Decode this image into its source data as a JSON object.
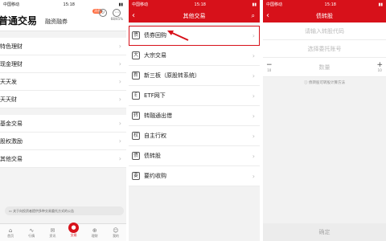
{
  "screen1": {
    "status": {
      "carrier": "中国移动",
      "time": "15:18"
    },
    "title": "普通交易",
    "subtitle": "融资融券",
    "badge": "消息",
    "icon_labels": [
      "",
      "68/45%"
    ],
    "items": [
      "特色理财",
      "现金理财",
      "天天发",
      "天天财",
      "基金交易",
      "股权激励",
      "其他交易"
    ],
    "notice": "关于向投资者提供多种交易委托方式的公告",
    "tabs": [
      {
        "icon": "⌂",
        "label": "首页"
      },
      {
        "icon": "∿",
        "label": "行情"
      },
      {
        "icon": "✉",
        "label": "资讯"
      },
      {
        "icon": "●",
        "label": "交易"
      },
      {
        "icon": "⊕",
        "label": "理财"
      },
      {
        "icon": "☺",
        "label": "我的"
      }
    ]
  },
  "screen2": {
    "status": {
      "carrier": "中国移动",
      "time": "15:18"
    },
    "title": "其他交易",
    "items": [
      {
        "icon": "债",
        "label": "债券回购"
      },
      {
        "icon": "大",
        "label": "大宗交易"
      },
      {
        "icon": "新",
        "label": "新三板（原股转系统）"
      },
      {
        "icon": "E",
        "label": "ETF网下"
      },
      {
        "icon": "转",
        "label": "转融通出借"
      },
      {
        "icon": "权",
        "label": "自主行权"
      },
      {
        "icon": "债",
        "label": "债转股"
      },
      {
        "icon": "要",
        "label": "要约收购"
      }
    ]
  },
  "screen3": {
    "status": {
      "carrier": "中国移动",
      "time": "15:18"
    },
    "title": "债转股",
    "code_placeholder": "请输入转股代码",
    "account_placeholder": "选择委托账号",
    "qty_placeholder": "数量",
    "minus_step": "10",
    "plus_step": "10",
    "tip": "债转股可转股计算方法",
    "confirm": "确定"
  },
  "colors": {
    "brand_red": "#d7111a"
  }
}
